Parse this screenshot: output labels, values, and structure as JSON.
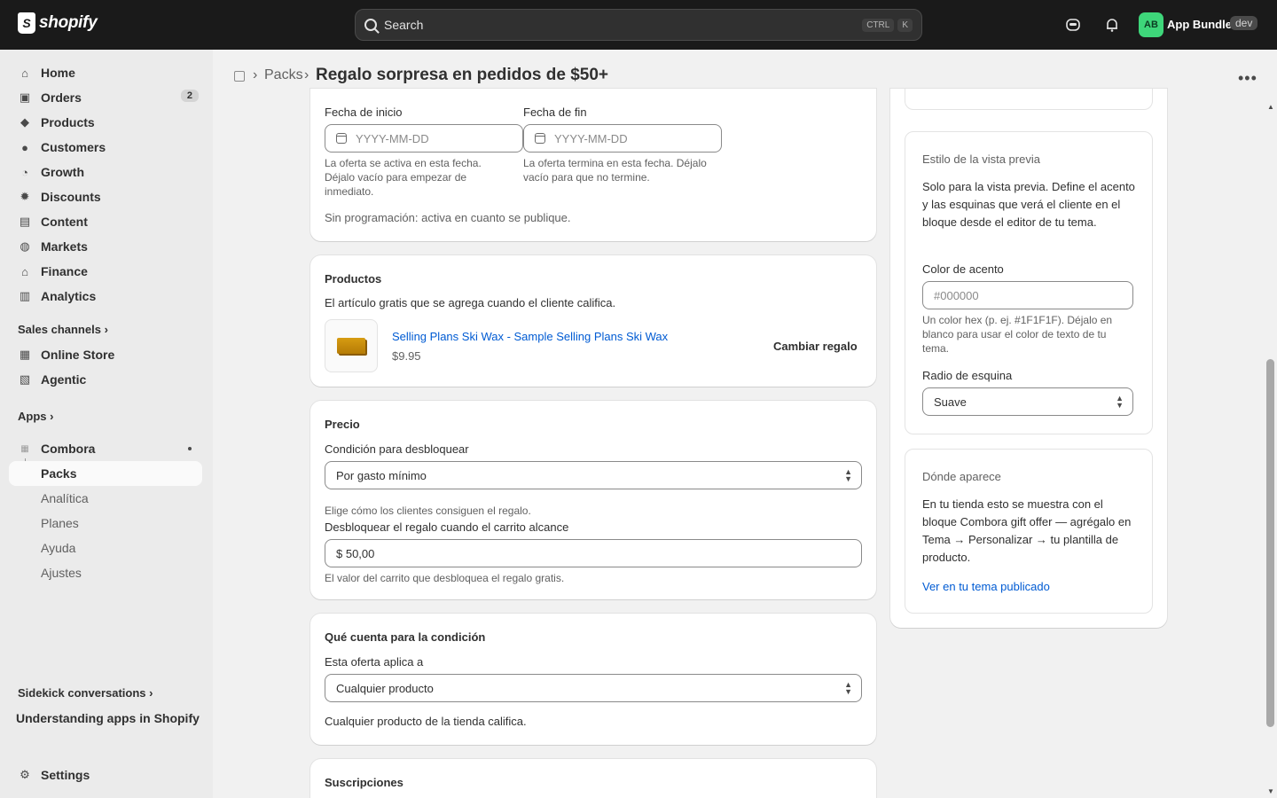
{
  "topbar": {
    "logo_text": "shopify",
    "search_placeholder": "Search",
    "shortcut_key1": "CTRL",
    "shortcut_key2": "K",
    "avatar_initials": "AB",
    "store_name": "App Bundle",
    "env_badge": "dev"
  },
  "sidebar": {
    "items": [
      {
        "label": "Home",
        "icon": "home-icon"
      },
      {
        "label": "Orders",
        "icon": "orders-icon",
        "badge": "2"
      },
      {
        "label": "Products",
        "icon": "tag-icon"
      },
      {
        "label": "Customers",
        "icon": "person-icon"
      },
      {
        "label": "Growth",
        "icon": "growth-icon"
      },
      {
        "label": "Discounts",
        "icon": "discount-icon"
      },
      {
        "label": "Content",
        "icon": "content-icon"
      },
      {
        "label": "Markets",
        "icon": "globe-icon"
      },
      {
        "label": "Finance",
        "icon": "bank-icon"
      },
      {
        "label": "Analytics",
        "icon": "chart-icon"
      }
    ],
    "sales_channels_label": "Sales channels",
    "channels": [
      {
        "label": "Online Store",
        "icon": "store-icon"
      },
      {
        "label": "Agentic",
        "icon": "agentic-icon"
      }
    ],
    "apps_label": "Apps",
    "app_name": "Combora",
    "app_subitems": [
      "Packs",
      "Analítica",
      "Planes",
      "Ayuda",
      "Ajustes"
    ],
    "sidekick_label": "Sidekick conversations",
    "sidekick_item": "Understanding apps in Shopify",
    "settings_label": "Settings"
  },
  "header": {
    "breadcrumb": "Packs",
    "title": "Regalo sorpresa en pedidos de $50+"
  },
  "schedule": {
    "start_label": "Fecha de inicio",
    "start_placeholder": "YYYY-MM-DD",
    "start_help": "La oferta se activa en esta fecha. Déjalo vacío para empezar de inmediato.",
    "end_label": "Fecha de fin",
    "end_placeholder": "YYYY-MM-DD",
    "end_help": "La oferta termina en esta fecha. Déjalo vacío para que no termine.",
    "status": "Sin programación: activa en cuanto se publique."
  },
  "products": {
    "title": "Productos",
    "description": "El artículo gratis que se agrega cuando el cliente califica.",
    "item_name": "Selling Plans Ski Wax - Sample Selling Plans Ski Wax",
    "item_price": "$9.95",
    "change_button": "Cambiar regalo"
  },
  "pricing": {
    "title": "Precio",
    "condition_label": "Condición para desbloquear",
    "condition_value": "Por gasto mínimo",
    "condition_help": "Elige cómo los clientes consiguen el regalo.",
    "threshold_label": "Desbloquear el regalo cuando el carrito alcance",
    "threshold_value": "$ 50,00",
    "threshold_help": "El valor del carrito que desbloquea el regalo gratis."
  },
  "qualifying": {
    "title": "Qué cuenta para la condición",
    "applies_label": "Esta oferta aplica a",
    "applies_value": "Cualquier producto",
    "applies_help": "Cualquier producto de la tienda califica."
  },
  "subscriptions": {
    "title": "Suscripciones"
  },
  "preview_style": {
    "title": "Estilo de la vista previa",
    "description": "Solo para la vista previa. Define el acento y las esquinas que verá el cliente en el bloque desde el editor de tu tema.",
    "accent_label": "Color de acento",
    "accent_placeholder": "#000000",
    "accent_help": "Un color hex (p. ej. #1F1F1F). Déjalo en blanco para usar el color de texto de tu tema.",
    "radius_label": "Radio de esquina",
    "radius_value": "Suave"
  },
  "where": {
    "title": "Dónde aparece",
    "description": "En tu tienda esto se muestra con el bloque Combora gift offer — agrégalo en Tema → Personalizar → tu plantilla de producto.",
    "link": "Ver en tu tema publicado"
  },
  "colors": {
    "topbar": "#1a1a1a",
    "accent_link": "#005bd3",
    "avatar": "#3ed67a"
  }
}
